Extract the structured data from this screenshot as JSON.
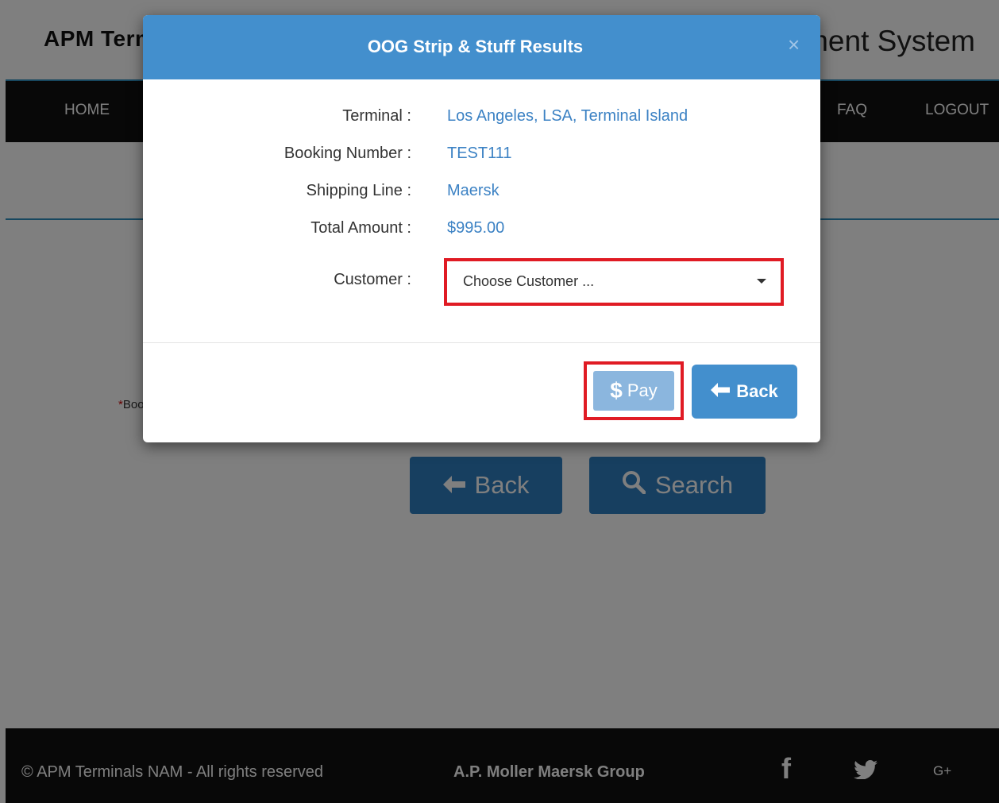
{
  "app": {
    "brand": "APM Terminals",
    "system_title": "Appointment System"
  },
  "nav": {
    "home": "HOME",
    "faq": "FAQ",
    "logout": "LOGOUT"
  },
  "background_form": {
    "required_label": "Booking Number",
    "back_button": "Back",
    "search_button": "Search"
  },
  "modal": {
    "title": "OOG Strip & Stuff Results",
    "close": "×",
    "rows": [
      {
        "label": "Terminal :",
        "value": "Los Angeles, LSA, Terminal Island"
      },
      {
        "label": "Booking Number :",
        "value": "TEST111"
      },
      {
        "label": "Shipping Line :",
        "value": "Maersk"
      },
      {
        "label": "Total Amount :",
        "value": "$995.00"
      }
    ],
    "customer": {
      "label": "Customer :",
      "selected": "Choose Customer ..."
    },
    "pay_button": {
      "icon": "$",
      "label": "Pay"
    },
    "back_button": {
      "label": "Back"
    }
  },
  "footer": {
    "copyright": "© APM Terminals NAM - All rights reserved",
    "group": "A.P. Moller Maersk Group",
    "social": [
      "facebook-icon",
      "twitter-icon",
      "google-plus-icon"
    ],
    "google_plus_text": "G+"
  },
  "colors": {
    "modal_header": "#438fcd",
    "highlight": "#e01b24",
    "value_text": "#3c82c4",
    "pay_button": "#8bb6de"
  }
}
